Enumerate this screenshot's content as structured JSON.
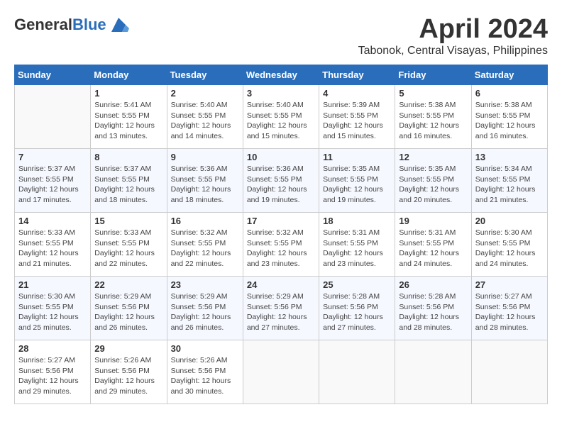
{
  "header": {
    "logo_general": "General",
    "logo_blue": "Blue",
    "month_title": "April 2024",
    "location": "Tabonok, Central Visayas, Philippines"
  },
  "calendar": {
    "days_of_week": [
      "Sunday",
      "Monday",
      "Tuesday",
      "Wednesday",
      "Thursday",
      "Friday",
      "Saturday"
    ],
    "weeks": [
      [
        {
          "day": "",
          "sunrise": "",
          "sunset": "",
          "daylight": "",
          "empty": true
        },
        {
          "day": "1",
          "sunrise": "Sunrise: 5:41 AM",
          "sunset": "Sunset: 5:55 PM",
          "daylight": "Daylight: 12 hours and 13 minutes.",
          "empty": false
        },
        {
          "day": "2",
          "sunrise": "Sunrise: 5:40 AM",
          "sunset": "Sunset: 5:55 PM",
          "daylight": "Daylight: 12 hours and 14 minutes.",
          "empty": false
        },
        {
          "day": "3",
          "sunrise": "Sunrise: 5:40 AM",
          "sunset": "Sunset: 5:55 PM",
          "daylight": "Daylight: 12 hours and 15 minutes.",
          "empty": false
        },
        {
          "day": "4",
          "sunrise": "Sunrise: 5:39 AM",
          "sunset": "Sunset: 5:55 PM",
          "daylight": "Daylight: 12 hours and 15 minutes.",
          "empty": false
        },
        {
          "day": "5",
          "sunrise": "Sunrise: 5:38 AM",
          "sunset": "Sunset: 5:55 PM",
          "daylight": "Daylight: 12 hours and 16 minutes.",
          "empty": false
        },
        {
          "day": "6",
          "sunrise": "Sunrise: 5:38 AM",
          "sunset": "Sunset: 5:55 PM",
          "daylight": "Daylight: 12 hours and 16 minutes.",
          "empty": false
        }
      ],
      [
        {
          "day": "7",
          "sunrise": "Sunrise: 5:37 AM",
          "sunset": "Sunset: 5:55 PM",
          "daylight": "Daylight: 12 hours and 17 minutes.",
          "empty": false
        },
        {
          "day": "8",
          "sunrise": "Sunrise: 5:37 AM",
          "sunset": "Sunset: 5:55 PM",
          "daylight": "Daylight: 12 hours and 18 minutes.",
          "empty": false
        },
        {
          "day": "9",
          "sunrise": "Sunrise: 5:36 AM",
          "sunset": "Sunset: 5:55 PM",
          "daylight": "Daylight: 12 hours and 18 minutes.",
          "empty": false
        },
        {
          "day": "10",
          "sunrise": "Sunrise: 5:36 AM",
          "sunset": "Sunset: 5:55 PM",
          "daylight": "Daylight: 12 hours and 19 minutes.",
          "empty": false
        },
        {
          "day": "11",
          "sunrise": "Sunrise: 5:35 AM",
          "sunset": "Sunset: 5:55 PM",
          "daylight": "Daylight: 12 hours and 19 minutes.",
          "empty": false
        },
        {
          "day": "12",
          "sunrise": "Sunrise: 5:35 AM",
          "sunset": "Sunset: 5:55 PM",
          "daylight": "Daylight: 12 hours and 20 minutes.",
          "empty": false
        },
        {
          "day": "13",
          "sunrise": "Sunrise: 5:34 AM",
          "sunset": "Sunset: 5:55 PM",
          "daylight": "Daylight: 12 hours and 21 minutes.",
          "empty": false
        }
      ],
      [
        {
          "day": "14",
          "sunrise": "Sunrise: 5:33 AM",
          "sunset": "Sunset: 5:55 PM",
          "daylight": "Daylight: 12 hours and 21 minutes.",
          "empty": false
        },
        {
          "day": "15",
          "sunrise": "Sunrise: 5:33 AM",
          "sunset": "Sunset: 5:55 PM",
          "daylight": "Daylight: 12 hours and 22 minutes.",
          "empty": false
        },
        {
          "day": "16",
          "sunrise": "Sunrise: 5:32 AM",
          "sunset": "Sunset: 5:55 PM",
          "daylight": "Daylight: 12 hours and 22 minutes.",
          "empty": false
        },
        {
          "day": "17",
          "sunrise": "Sunrise: 5:32 AM",
          "sunset": "Sunset: 5:55 PM",
          "daylight": "Daylight: 12 hours and 23 minutes.",
          "empty": false
        },
        {
          "day": "18",
          "sunrise": "Sunrise: 5:31 AM",
          "sunset": "Sunset: 5:55 PM",
          "daylight": "Daylight: 12 hours and 23 minutes.",
          "empty": false
        },
        {
          "day": "19",
          "sunrise": "Sunrise: 5:31 AM",
          "sunset": "Sunset: 5:55 PM",
          "daylight": "Daylight: 12 hours and 24 minutes.",
          "empty": false
        },
        {
          "day": "20",
          "sunrise": "Sunrise: 5:30 AM",
          "sunset": "Sunset: 5:55 PM",
          "daylight": "Daylight: 12 hours and 24 minutes.",
          "empty": false
        }
      ],
      [
        {
          "day": "21",
          "sunrise": "Sunrise: 5:30 AM",
          "sunset": "Sunset: 5:55 PM",
          "daylight": "Daylight: 12 hours and 25 minutes.",
          "empty": false
        },
        {
          "day": "22",
          "sunrise": "Sunrise: 5:29 AM",
          "sunset": "Sunset: 5:56 PM",
          "daylight": "Daylight: 12 hours and 26 minutes.",
          "empty": false
        },
        {
          "day": "23",
          "sunrise": "Sunrise: 5:29 AM",
          "sunset": "Sunset: 5:56 PM",
          "daylight": "Daylight: 12 hours and 26 minutes.",
          "empty": false
        },
        {
          "day": "24",
          "sunrise": "Sunrise: 5:29 AM",
          "sunset": "Sunset: 5:56 PM",
          "daylight": "Daylight: 12 hours and 27 minutes.",
          "empty": false
        },
        {
          "day": "25",
          "sunrise": "Sunrise: 5:28 AM",
          "sunset": "Sunset: 5:56 PM",
          "daylight": "Daylight: 12 hours and 27 minutes.",
          "empty": false
        },
        {
          "day": "26",
          "sunrise": "Sunrise: 5:28 AM",
          "sunset": "Sunset: 5:56 PM",
          "daylight": "Daylight: 12 hours and 28 minutes.",
          "empty": false
        },
        {
          "day": "27",
          "sunrise": "Sunrise: 5:27 AM",
          "sunset": "Sunset: 5:56 PM",
          "daylight": "Daylight: 12 hours and 28 minutes.",
          "empty": false
        }
      ],
      [
        {
          "day": "28",
          "sunrise": "Sunrise: 5:27 AM",
          "sunset": "Sunset: 5:56 PM",
          "daylight": "Daylight: 12 hours and 29 minutes.",
          "empty": false
        },
        {
          "day": "29",
          "sunrise": "Sunrise: 5:26 AM",
          "sunset": "Sunset: 5:56 PM",
          "daylight": "Daylight: 12 hours and 29 minutes.",
          "empty": false
        },
        {
          "day": "30",
          "sunrise": "Sunrise: 5:26 AM",
          "sunset": "Sunset: 5:56 PM",
          "daylight": "Daylight: 12 hours and 30 minutes.",
          "empty": false
        },
        {
          "day": "",
          "sunrise": "",
          "sunset": "",
          "daylight": "",
          "empty": true
        },
        {
          "day": "",
          "sunrise": "",
          "sunset": "",
          "daylight": "",
          "empty": true
        },
        {
          "day": "",
          "sunrise": "",
          "sunset": "",
          "daylight": "",
          "empty": true
        },
        {
          "day": "",
          "sunrise": "",
          "sunset": "",
          "daylight": "",
          "empty": true
        }
      ]
    ]
  }
}
